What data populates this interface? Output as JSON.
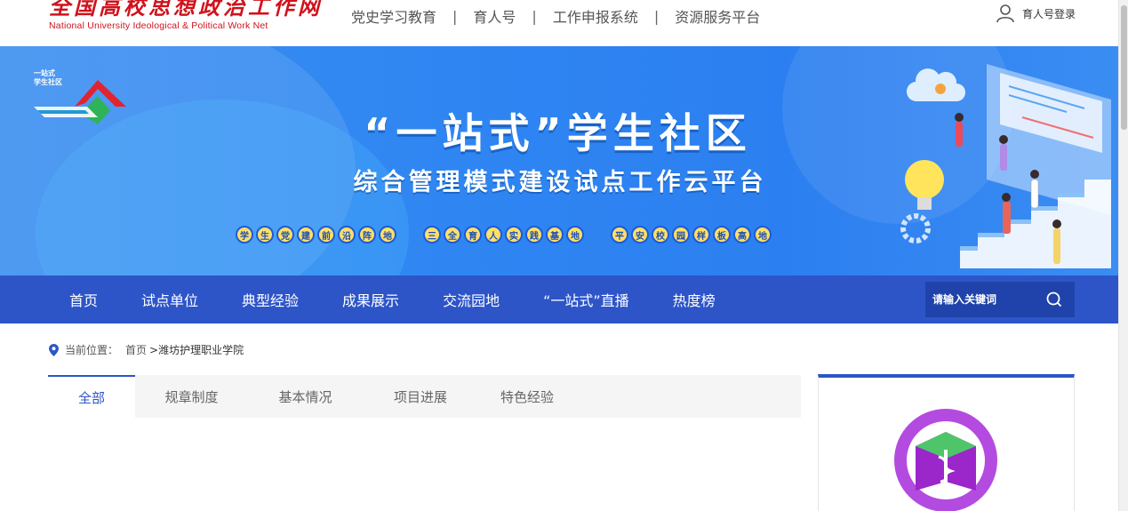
{
  "header": {
    "logo_cn": "全国高校思想政治工作网",
    "logo_en": "National University Ideological & Political Work Net",
    "topnav": [
      "党史学习教育",
      "育人号",
      "工作申报系统",
      "资源服务平台"
    ],
    "separator": "|",
    "login_label": "育人号登录"
  },
  "banner": {
    "logo_line1": "一站式",
    "logo_line2": "学生社区",
    "title": "“一站式”学生社区",
    "subtitle": "综合管理模式建设试点工作云平台",
    "slogans": [
      [
        "学",
        "生",
        "党",
        "建",
        "前",
        "沿",
        "阵",
        "地"
      ],
      [
        "三",
        "全",
        "育",
        "人",
        "实",
        "践",
        "基",
        "地"
      ],
      [
        "平",
        "安",
        "校",
        "园",
        "样",
        "板",
        "高",
        "地"
      ]
    ]
  },
  "mainnav": {
    "items": [
      "首页",
      "试点单位",
      "典型经验",
      "成果展示",
      "交流园地",
      "“一站式”直播",
      "热度榜"
    ],
    "search_placeholder": "请输入关键词"
  },
  "breadcrumb": {
    "label": "当前位置：",
    "home": "首页",
    "current": ">潍坊护理职业学院"
  },
  "tabs": [
    "全部",
    "规章制度",
    "基本情况",
    "项目进展",
    "特色经验"
  ],
  "colors": {
    "brand_red": "#d0121b",
    "nav_blue": "#2d55c8",
    "banner_blue": "#2f86f2",
    "slogan_yellow": "#ffe066"
  }
}
